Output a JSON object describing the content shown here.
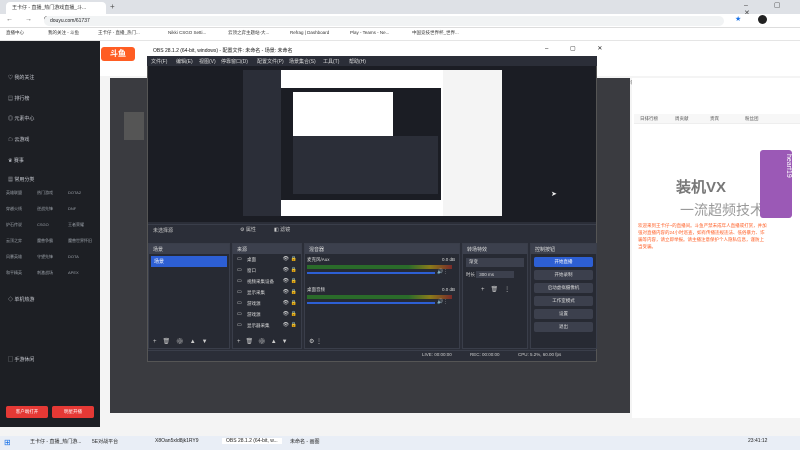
{
  "browser": {
    "tab_title": "王卡仔 - 直播_热门游戏直播_斗...",
    "url": "douyu.com/61737",
    "bookmarks": [
      "直播中心",
      "我的关注 - 斗鱼",
      "王卡仔 - 直播_热门...",
      "Nikki CSGO Setti...",
      "云顶之弈主题站-大...",
      "Refrag | Dashboard",
      "Play - Teams - Ne...",
      "中国竞技世界杯_世界..."
    ]
  },
  "site": {
    "room_number_partial": "12",
    "header_right": [
      "成为主播",
      "领取",
      "历史",
      "PC客户端"
    ],
    "nav": [
      "我的关注",
      "排行榜",
      "元素中心",
      "云游戏",
      "赛事",
      "常用分类",
      "推荐分类"
    ],
    "categories": [
      [
        "英雄联盟",
        "热门游戏",
        "DOTA2"
      ],
      [
        "穿越火线",
        "逆战先锋",
        "DNF"
      ],
      [
        "炉石传说",
        "CSGO",
        "王者荣耀"
      ],
      [
        "云顶之弈",
        "魔兽争霸",
        "魔兽世界怀旧"
      ],
      [
        "风暴英雄",
        "守望先锋",
        "DOTA"
      ],
      [
        "和平精英",
        "刺激战场",
        "APEX"
      ]
    ],
    "nav_section2": "单机热游",
    "nav_section3": "手游休闲",
    "left_buttons": [
      "客户端打开",
      "明星开播"
    ],
    "chat_tabs": [
      "日排行榜",
      "周贡献",
      "贵宾",
      "粉丝团"
    ],
    "ad_text_1": "装机VX",
    "ad_text_2": "一流超频技术",
    "ad_side": "hearf19",
    "chat_notice": "欢迎来到王卡仔~的直播间。斗鱼严禁未成年人直播或打赏，并加强对直播内容的24小时巡查，如有传播违规违法、低俗暴力、诈骗等内容，请立即举报。请主播注意保护个人隐私信息，谨防上当受骗。"
  },
  "obs": {
    "title": "OBS 28.1.2 (64-bit, windows) - 配置文件: 未命名 - 场景: 未命名",
    "menu": [
      "文件(F)",
      "编辑(E)",
      "视图(V)",
      "停靠窗口(D)",
      "配置文件(P)",
      "场景集合(S)",
      "工具(T)",
      "帮助(H)"
    ],
    "no_source_label": "未选择源",
    "props_label": "属性",
    "filters_label": "滤镜",
    "docks": {
      "scenes": {
        "title": "场景",
        "items": [
          "场景"
        ]
      },
      "sources": {
        "title": "来源",
        "items": [
          "桌面",
          "窗口",
          "视频采集设备",
          "显示采集",
          "游戏源",
          "游戏源",
          "显示器采集"
        ]
      },
      "mixer": {
        "title": "混音器",
        "channels": [
          {
            "name": "麦克风/Aux",
            "db": "0.0 dB"
          },
          {
            "name": "桌面音频",
            "db": "0.0 dB"
          }
        ]
      },
      "transitions": {
        "title": "转场特效",
        "type": "渐变",
        "duration_label": "时长",
        "duration": "300 ms"
      },
      "controls": {
        "title": "控制按钮",
        "buttons": [
          "开始直播",
          "开始录制",
          "启动虚拟摄像机",
          "工作室模式",
          "设置",
          "退出"
        ]
      }
    },
    "status": {
      "live": "LIVE: 00:00:00",
      "rec": "REC: 00:00:00",
      "cpu": "CPU: 5.2%, 60.00 fps"
    }
  },
  "taskbar": {
    "items": [
      "王卡仔 - 直播_热门游...",
      "5E对战平台",
      "X8Oan5xld8jk1RY9",
      "OBS 28.1.2 (64-bit, w...",
      "未命名 - 画图"
    ],
    "clock": "23:41:12"
  },
  "colors": {
    "obs_blue": "#2d5fd4",
    "douyu_orange": "#ff5d23",
    "red": "#e53935"
  }
}
